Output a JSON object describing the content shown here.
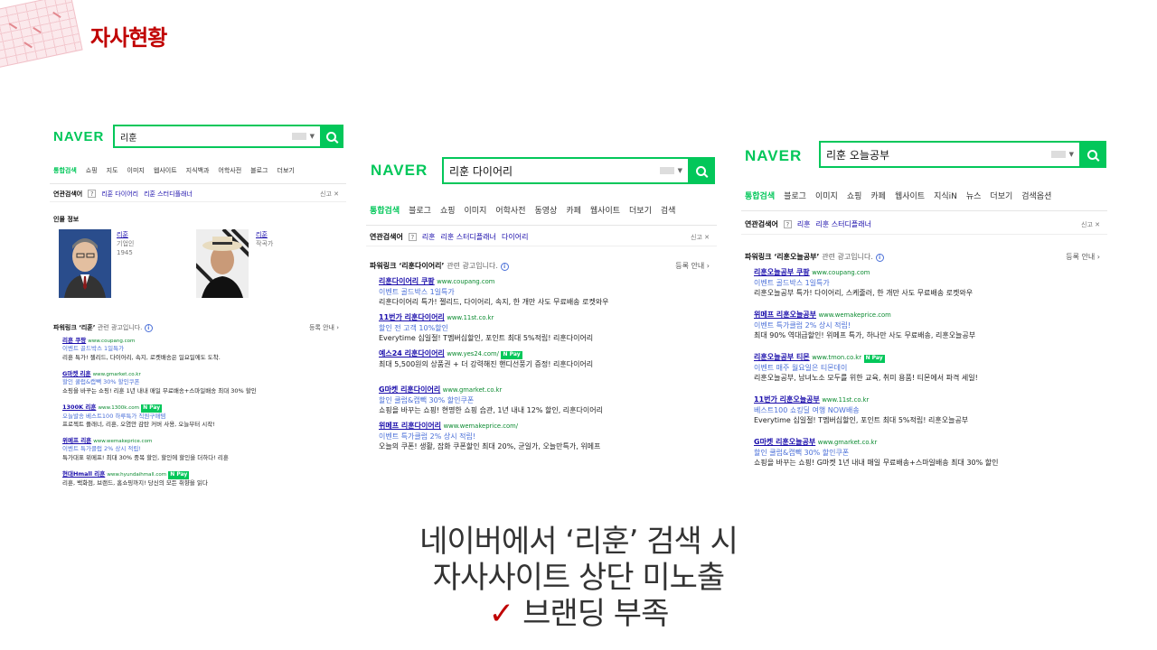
{
  "slide": {
    "title": "자사현황",
    "caption_lines": [
      "네이버에서 ‘리훈’ 검색 시",
      "자사사이트 상단 미노출",
      "브랜딩 부족"
    ],
    "check_icon": "✓",
    "accent_color": "#c00000",
    "naver_green": "#03c75a"
  },
  "panel1": {
    "logo": "NAVER",
    "query": "리훈",
    "tabs": [
      "통합검색",
      "쇼핑",
      "지도",
      "이미지",
      "웹사이트",
      "지식백과",
      "어학사전",
      "블로그",
      "더보기"
    ],
    "related": {
      "heading": "연관검색어",
      "items": [
        "리훈 다이어리",
        "리훈 스터디플래너"
      ],
      "report": "신고"
    },
    "people": {
      "heading": "인물 정보",
      "items": [
        {
          "name": "리훈",
          "role": "기업인",
          "year": "1945"
        },
        {
          "name": "리훈",
          "role": "작곡가",
          "year": ""
        }
      ]
    },
    "powerlink": {
      "heading": "파워링크 ‘리훈’",
      "sub": "관련 광고입니다.",
      "register": "등록 안내"
    },
    "ads": [
      {
        "title": "리훈 쿠팡",
        "url": "www.coupang.com",
        "event": "이벤트   골드박스 1일특가",
        "desc": "리훈 특가! 젤리드, 다이어리, 속지, 로켓배송은 일요일에도 도착.",
        "pay": ""
      },
      {
        "title": "G마켓 리훈",
        "url": "www.gmarket.co.kr",
        "event": "할인   쿨럽&캡빽 30% 할인쿠폰",
        "desc": "쇼핑을 바꾸는 쇼핑! 리훈 1년 내내 매일 무료배송+스마일배송 최대 30% 할인",
        "pay": ""
      },
      {
        "title": "1300K 리훈",
        "url": "www.1300k.com",
        "event": "오늘발송   베스트100   하루특가   직원구매템",
        "desc": "프로젝트 플래너, 리훈, 오염안 감탄 커버 사용, 오늘부터 시작!",
        "pay": "N Pay"
      },
      {
        "title": "위메프 리훈",
        "url": "www.wemakeprice.com",
        "event": "이벤트   특가클럽 2% 상시 적립!",
        "desc": "특가대표 위메프! 최대 30% 중복 할인, 할인에 할인을 더하다! 리훈",
        "pay": ""
      },
      {
        "title": "현대Hmall 리훈",
        "url": "www.hyundaihmall.com",
        "event": "",
        "desc": "리훈, 백화점, 브랜드, 홈쇼핑까지! 당신의 모든 취향을 읽다",
        "pay": "N Pay"
      }
    ]
  },
  "panel2": {
    "logo": "NAVER",
    "query": "리훈 다이어리",
    "tabs": [
      "통합검색",
      "블로그",
      "쇼핑",
      "이미지",
      "어학사전",
      "동영상",
      "카페",
      "웹사이트",
      "더보기",
      "검색"
    ],
    "related": {
      "heading": "연관검색어",
      "items": [
        "리훈",
        "리훈 스터디플래너",
        "다이어리"
      ],
      "report": "신고"
    },
    "powerlink": {
      "heading": "파워링크 ‘리훈다이어리’",
      "sub": "관련 광고입니다.",
      "register": "등록 안내"
    },
    "ads": [
      {
        "title": "리훈다이어리 쿠팡",
        "url": "www.coupang.com",
        "event": "이벤트   골드박스 1일특가",
        "desc": "리훈다이어리 특가! 젤리드, 다이어리, 속지, 한 개만 사도 무료배송 로켓와우",
        "pay": ""
      },
      {
        "title": "11번가 리훈다이어리",
        "url": "www.11st.co.kr",
        "event": "할인   전 고객 10%할인",
        "desc": "Everytime 십일절! T멤버십할인, 포인트 최대 5%적립! 리훈다이어리",
        "pay": ""
      },
      {
        "title": "예스24 리훈다이어리",
        "url": "www.yes24.com/",
        "event": "",
        "desc": "최대 5,500원의 상품권 + 더 강력해진 핸디선풍기 증정! 리훈다이어리",
        "pay": "N Pay"
      },
      {
        "title": "G마켓 리훈다이어리",
        "url": "www.gmarket.co.kr",
        "event": "할인   쿨럽&캡빽 30% 할인쿠폰",
        "desc": "쇼핑을 바꾸는 쇼핑! 현명한 쇼핑 습관, 1년 내내 12% 할인, 리훈다이어리",
        "pay": ""
      },
      {
        "title": "위메프 리훈다이어리",
        "url": "www.wemakeprice.com/",
        "event": "이벤트   특가클럽 2% 상시 적립!",
        "desc": "오늘의 쿠폰! 생활, 잡화 쿠폰할인 최대 20%, 균일가, 오늘만특가, 위메프",
        "pay": ""
      }
    ]
  },
  "panel3": {
    "logo": "NAVER",
    "query": "리훈 오늘공부",
    "tabs": [
      "통합검색",
      "블로그",
      "이미지",
      "쇼핑",
      "카페",
      "웹사이트",
      "지식iN",
      "뉴스",
      "더보기",
      "검색옵션"
    ],
    "related": {
      "heading": "연관검색어",
      "items": [
        "리훈",
        "리훈 스터디플래너"
      ],
      "report": "신고"
    },
    "powerlink": {
      "heading": "파워링크 ‘리훈오늘공부’",
      "sub": "관련 광고입니다.",
      "register": "등록 안내"
    },
    "ads": [
      {
        "title": "리훈오늘공부 쿠팡",
        "url": "www.coupang.com",
        "event": "이벤트   골드박스 1일특가",
        "desc": "리훈오늘공부 특가! 다이어리, 스케줄러, 한 개만 사도 무료배송 로켓와우",
        "pay": ""
      },
      {
        "title": "위메프 리훈오늘공부",
        "url": "www.wemakeprice.com",
        "event": "이벤트   특가클럽 2% 상시 적립!",
        "desc": "최대 90% 역대급할인! 위메프 특가, 하나만 사도 무료배송, 리훈오늘공부",
        "pay": ""
      },
      {
        "title": "리훈오늘공부 티몬",
        "url": "www.tmon.co.kr",
        "event": "이벤트   매주 월요일은 티몬데이",
        "desc": "리훈오늘공부, 남녀노소 모두를 위한 교육, 취미 용품! 티몬에서 파격 세일!",
        "pay": "N Pay"
      },
      {
        "title": "11번가 리훈오늘공부",
        "url": "www.11st.co.kr",
        "event": "베스트100   쇼킹딜   여행   NOW배송",
        "desc": "Everytime 십일절! T멤버십할인, 포인트 최대 5%적립! 리훈오늘공부",
        "pay": ""
      },
      {
        "title": "G마켓 리훈오늘공부",
        "url": "www.gmarket.co.kr",
        "event": "할인   쿨럽&캡빽 30% 할인쿠폰",
        "desc": "쇼핑을 바꾸는 쇼핑! G마켓 1년 내내 매일 무료배송+스마일배송 최대 30% 할인",
        "pay": ""
      }
    ]
  }
}
